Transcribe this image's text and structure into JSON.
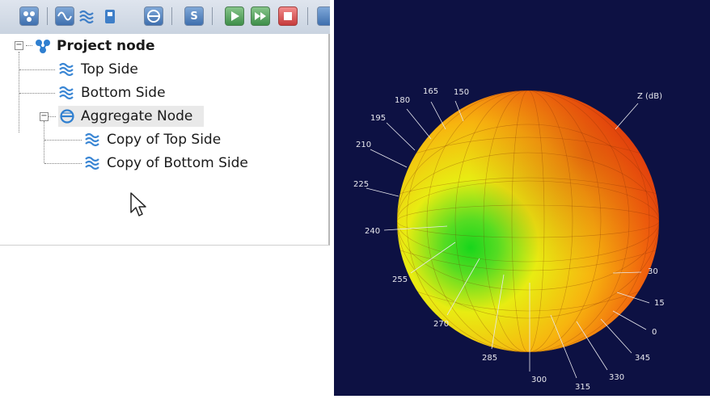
{
  "tree": {
    "items": [
      {
        "label": "Project node",
        "icon": "project-node-icon",
        "bold": true
      },
      {
        "label": "Top Side",
        "icon": "wave-icon"
      },
      {
        "label": "Bottom Side",
        "icon": "wave-icon"
      },
      {
        "label": "Aggregate Node",
        "icon": "aggregate-node-icon"
      },
      {
        "label": "Copy of Top Side",
        "icon": "wave-icon"
      },
      {
        "label": "Copy of Bottom Side",
        "icon": "wave-icon"
      }
    ]
  },
  "toolbar": {
    "buttons": [
      {
        "icon": "project-node-icon"
      },
      {
        "icon": "sine-wave-icon"
      },
      {
        "icon": "multi-wave-icon"
      },
      {
        "icon": "device-icon"
      },
      {
        "icon": "aggregate-icon"
      },
      {
        "icon": "s-icon",
        "text": "S"
      },
      {
        "icon": "play-icon"
      },
      {
        "icon": "fast-forward-icon"
      },
      {
        "icon": "stop-icon"
      }
    ]
  },
  "plot": {
    "axis_label": "Z (dB)",
    "angle_labels": [
      "165",
      "150",
      "180",
      "195",
      "210",
      "225",
      "240",
      "255",
      "270",
      "285",
      "300",
      "315",
      "330",
      "345",
      "0",
      "15",
      "30"
    ],
    "colors": {
      "background": "#0d1143",
      "high": "#e01a10",
      "mid": "#f4ee10",
      "low": "#1ed81e"
    }
  }
}
